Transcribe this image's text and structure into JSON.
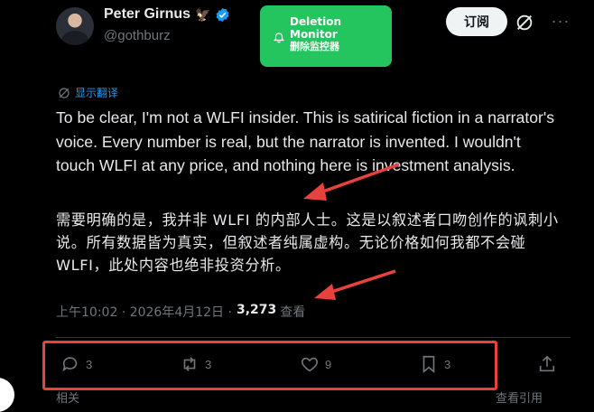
{
  "author": {
    "display_name": "Peter Girnus",
    "emoji": "🦅",
    "handle": "@gothburz"
  },
  "monitor_popup": {
    "title": "Deletion Monitor",
    "subtitle": "删除监控器"
  },
  "header_actions": {
    "subscribe_label": "订阅",
    "more_label": "···"
  },
  "translate": {
    "label": "显示翻译"
  },
  "tweet": {
    "text_en": "To be clear, I'm not a WLFI insider. This is satirical fiction in a narrator's voice. Every number is real, but the narrator is invented. I wouldn't touch WLFI at any price, and nothing here is investment analysis.",
    "text_zh": "需要明确的是，我并非 WLFI 的内部人士。这是以叙述者口吻创作的讽刺小说。所有数据皆为真实，但叙述者纯属虚构。无论价格如何我都不会碰 WLFI，此处内容也绝非投资分析。"
  },
  "meta": {
    "timestamp": "上午10:02 · 2026年4月12日 ·",
    "views_count": "3,273",
    "views_label": "查看"
  },
  "actions": {
    "replies": "3",
    "reposts": "3",
    "likes": "9",
    "bookmarks": "3"
  },
  "footer": {
    "related_label": "相关",
    "quotes_label": "查看引用"
  },
  "colors": {
    "background": "#000000",
    "text": "#e7e9ea",
    "muted": "#71767b",
    "link": "#1d9bf0",
    "popup": "#24c55e",
    "annotation": "#e8423f"
  }
}
